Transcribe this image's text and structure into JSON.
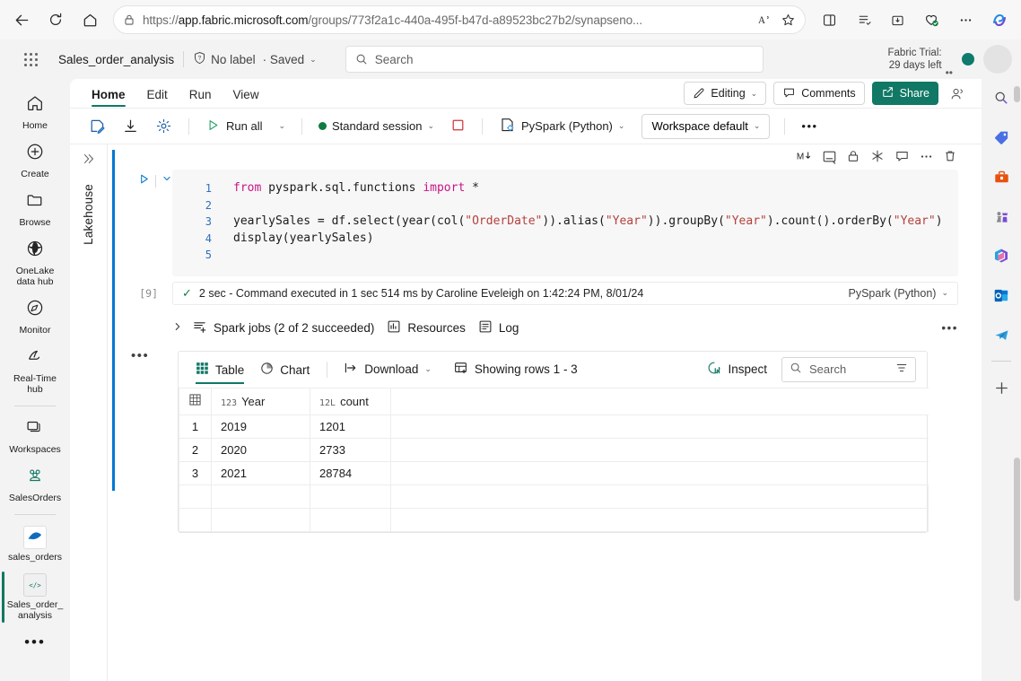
{
  "browser": {
    "url_prefix": "https://",
    "url_bold": "app.fabric.microsoft.com",
    "url_suffix": "/groups/773f2a1c-440a-495f-b47d-a89523bc27b2/synapseno...",
    "back_icon": "back-arrow-icon",
    "refresh_icon": "refresh-icon",
    "home_icon": "home-icon",
    "lock_icon": "lock-icon",
    "read_aloud_icon": "read-aloud-icon",
    "favorite_icon": "star-icon",
    "split_screen_icon": "split-screen-icon",
    "collections_icon": "collections-icon",
    "downloads_icon": "downloads-icon",
    "extensions_icon": "browser-essentials-icon",
    "settings_icon": "more-options-icon",
    "copilot_icon": "copilot-icon"
  },
  "topbar": {
    "waffle": "app-launcher-icon",
    "document_name": "Sales_order_analysis",
    "sensitivity_label": "No label",
    "shield_icon": "sensitivity-shield-icon",
    "saved_state": "· Saved",
    "saved_chevron": "⌄",
    "search_placeholder": "Search",
    "search_icon": "search-icon",
    "trial_line1": "Fabric Trial:",
    "trial_line2": "29 days left",
    "presence_color": "#0f7b6c"
  },
  "rail": {
    "items": [
      {
        "label": "Home",
        "icon": "home-icon"
      },
      {
        "label": "Create",
        "icon": "plus-circle-icon"
      },
      {
        "label": "Browse",
        "icon": "folder-icon"
      },
      {
        "label": "OneLake\ndata hub",
        "icon": "onelake-icon"
      },
      {
        "label": "Monitor",
        "icon": "monitor-compass-icon"
      },
      {
        "label": "Real-Time\nhub",
        "icon": "realtime-hub-icon"
      },
      {
        "label": "Workspaces",
        "icon": "workspaces-icon"
      },
      {
        "label": "SalesOrders",
        "icon": "workspace-group-icon"
      },
      {
        "label": "sales_orders",
        "icon": "lakehouse-icon"
      },
      {
        "label": "Sales_order_\nanalysis",
        "icon": "notebook-code-icon"
      }
    ],
    "more": "•••"
  },
  "right_rail": {
    "items": [
      "search-icon",
      "tag-icon",
      "toolbox-icon",
      "chess-icon",
      "microsoft365-icon",
      "outlook-icon",
      "telegram-icon",
      "add-icon"
    ]
  },
  "ribbon": {
    "tabs": [
      {
        "label": "Home",
        "active": true
      },
      {
        "label": "Edit",
        "active": false
      },
      {
        "label": "Run",
        "active": false
      },
      {
        "label": "View",
        "active": false
      }
    ],
    "editing_label": "Editing",
    "editing_icon": "pencil-icon",
    "comments_label": "Comments",
    "comments_icon": "comment-icon",
    "share_label": "Share",
    "share_icon": "share-icon",
    "share_color": "#117865",
    "share_people_icon": "share-people-icon"
  },
  "toolbar": {
    "save_icon": "save-notebook-icon",
    "export_icon": "download-icon",
    "settings_icon": "gear-icon",
    "run_all_label": "Run all",
    "run_all_icon": "play-icon",
    "session_label": "Standard session",
    "session_status_color": "#107c41",
    "stop_icon": "stop-square-icon",
    "stop_color": "#d13438",
    "language_label": "PySpark (Python)",
    "language_icon": "pyspark-icon",
    "environment_label": "Workspace default",
    "overflow_label": "•••"
  },
  "lakehouse_panel": {
    "expand_icon": "chevron-double-right-icon",
    "title": "Lakehouse"
  },
  "cell": {
    "accent_color": "#0078d4",
    "tools": [
      {
        "name": "markdown-toggle-icon",
        "glyph": "M↓"
      },
      {
        "name": "hide-output-icon",
        "glyph": "⊟"
      },
      {
        "name": "lock-cell-icon",
        "glyph": "🔒"
      },
      {
        "name": "freeze-cell-icon",
        "glyph": "✳"
      },
      {
        "name": "comment-cell-icon",
        "glyph": "💬"
      },
      {
        "name": "more-cell-options-icon",
        "glyph": "⋯"
      },
      {
        "name": "delete-cell-icon",
        "glyph": "🗑"
      }
    ],
    "run_icon": "run-cell-icon",
    "collapse_icon": "chevron-down-icon",
    "execution_index": "[9]",
    "code_lines": [
      {
        "n": "1",
        "tokens": [
          {
            "t": "from ",
            "c": "kw"
          },
          {
            "t": "pyspark.sql.functions ",
            "c": ""
          },
          {
            "t": "import",
            "c": "kw"
          },
          {
            "t": " *",
            "c": ""
          }
        ]
      },
      {
        "n": "2",
        "tokens": []
      },
      {
        "n": "3",
        "tokens": [
          {
            "t": "yearlySales = df.select(year(col(",
            "c": ""
          },
          {
            "t": "\"OrderDate\"",
            "c": "str"
          },
          {
            "t": ")).alias(",
            "c": ""
          },
          {
            "t": "\"Year\"",
            "c": "str"
          },
          {
            "t": ")).groupBy(",
            "c": ""
          },
          {
            "t": "\"Year\"",
            "c": "str"
          },
          {
            "t": ").count().orderBy(",
            "c": ""
          },
          {
            "t": "\"Year\"",
            "c": "str"
          },
          {
            "t": ")",
            "c": ""
          }
        ]
      },
      {
        "n": "4",
        "tokens": [
          {
            "t": "display(yearlySales)",
            "c": ""
          }
        ]
      },
      {
        "n": "5",
        "tokens": []
      }
    ],
    "status_check": "✓",
    "status_text": "2 sec - Command executed in 1 sec 514 ms by Caroline Eveleigh on 1:42:24 PM, 8/01/24",
    "status_language": "PySpark (Python)"
  },
  "jobs": {
    "expander": "›",
    "spark_jobs_label": "Spark jobs (2 of 2 succeeded)",
    "spark_jobs_icon": "spark-jobs-icon",
    "resources_label": "Resources",
    "resources_icon": "resources-chart-icon",
    "log_label": "Log",
    "log_icon": "log-list-icon",
    "more": "•••"
  },
  "output": {
    "left_dots": "•••",
    "table_tab": "Table",
    "table_icon": "table-grid-icon",
    "chart_tab": "Chart",
    "chart_icon": "pie-chart-icon",
    "download_label": "Download",
    "download_icon": "download-arrow-icon",
    "showing_rows": "Showing rows 1 - 3",
    "showing_rows_icon": "rows-settings-icon",
    "inspect_label": "Inspect",
    "inspect_icon": "inspect-chart-icon",
    "search_placeholder": "Search",
    "search_icon": "search-icon",
    "filter_icon": "filter-icon",
    "grid_corner_icon": "grid-corner-icon"
  },
  "table": {
    "columns": [
      {
        "name": "Year",
        "type_tag": "123"
      },
      {
        "name": "count",
        "type_tag": "12L"
      }
    ],
    "rows": [
      {
        "idx": "1",
        "Year": "2019",
        "count": "1201"
      },
      {
        "idx": "2",
        "Year": "2020",
        "count": "2733"
      },
      {
        "idx": "3",
        "Year": "2021",
        "count": "28784"
      }
    ]
  }
}
